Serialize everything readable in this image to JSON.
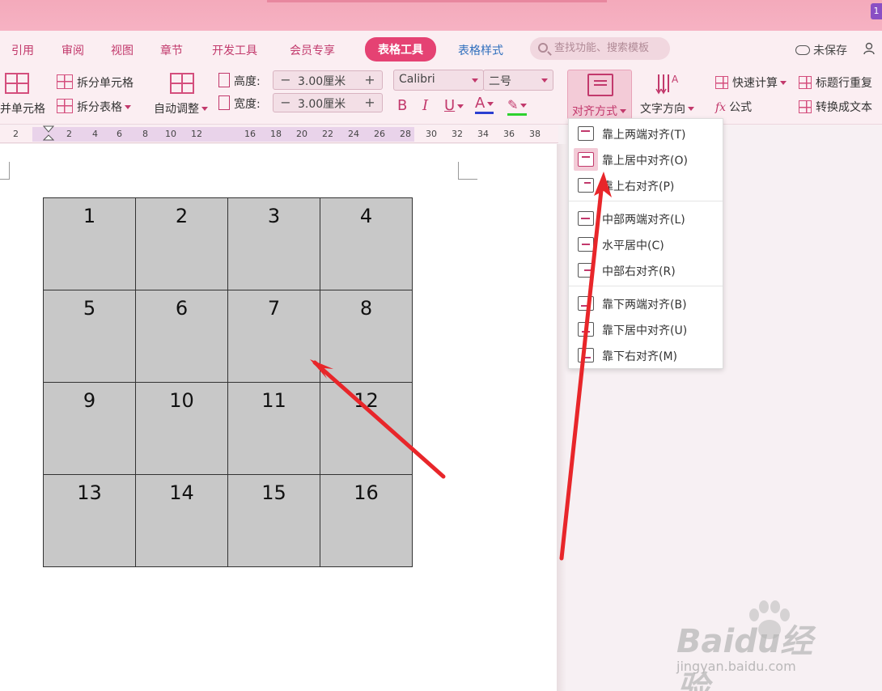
{
  "window": {
    "corner_badge": "1"
  },
  "menu": {
    "tabs": [
      {
        "label": "引用"
      },
      {
        "label": "审阅"
      },
      {
        "label": "视图"
      },
      {
        "label": "章节"
      },
      {
        "label": "开发工具"
      },
      {
        "label": "会员专享"
      },
      {
        "label": "表格工具",
        "active": true
      },
      {
        "label": "表格样式"
      }
    ],
    "search_placeholder": "查找功能、搜索模板",
    "save_status": "未保存"
  },
  "ribbon": {
    "merge_cells": "并单元格",
    "split_cell": "拆分单元格",
    "split_table": "拆分表格",
    "auto_fit": "自动调整",
    "height_label": "高度:",
    "width_label": "宽度:",
    "height_value": "3.00厘米",
    "width_value": "3.00厘米",
    "font_name": "Calibri",
    "font_size": "二号",
    "bold": "B",
    "italic": "I",
    "underline": "U",
    "font_color": "A",
    "align_mode": "对齐方式",
    "text_direction": "文字方向",
    "quick_calc": "快速计算",
    "formula": "公式",
    "repeat_header": "标题行重复",
    "convert_text": "转换成文本",
    "spin_minus": "−",
    "spin_plus": "+"
  },
  "ruler": {
    "ticks": [
      "2",
      "2",
      "4",
      "6",
      "8",
      "10",
      "12",
      "16",
      "18",
      "20",
      "22",
      "24",
      "26",
      "28",
      "30",
      "32",
      "34",
      "36",
      "38"
    ]
  },
  "table": {
    "rows": [
      [
        "1",
        "2",
        "3",
        "4"
      ],
      [
        "5",
        "6",
        "7",
        "8"
      ],
      [
        "9",
        "10",
        "11",
        "12"
      ],
      [
        "13",
        "14",
        "15",
        "16"
      ]
    ]
  },
  "align_menu": {
    "items": [
      {
        "label": "靠上两端对齐(T)"
      },
      {
        "label": "靠上居中对齐(O)",
        "highlighted": true
      },
      {
        "label": "靠上右对齐(P)"
      },
      {
        "label": "中部两端对齐(L)"
      },
      {
        "label": "水平居中(C)"
      },
      {
        "label": "中部右对齐(R)"
      },
      {
        "label": "靠下两端对齐(B)"
      },
      {
        "label": "靠下居中对齐(U)"
      },
      {
        "label": "靠下右对齐(M)"
      }
    ]
  },
  "watermark": {
    "brand": "Baidu经验",
    "url": "jingyan.baidu.com"
  },
  "colors": {
    "accent": "#e54273",
    "pink_text": "#c2396c",
    "arrow": "#e8262a",
    "cell_fill": "#c8c8c8"
  }
}
